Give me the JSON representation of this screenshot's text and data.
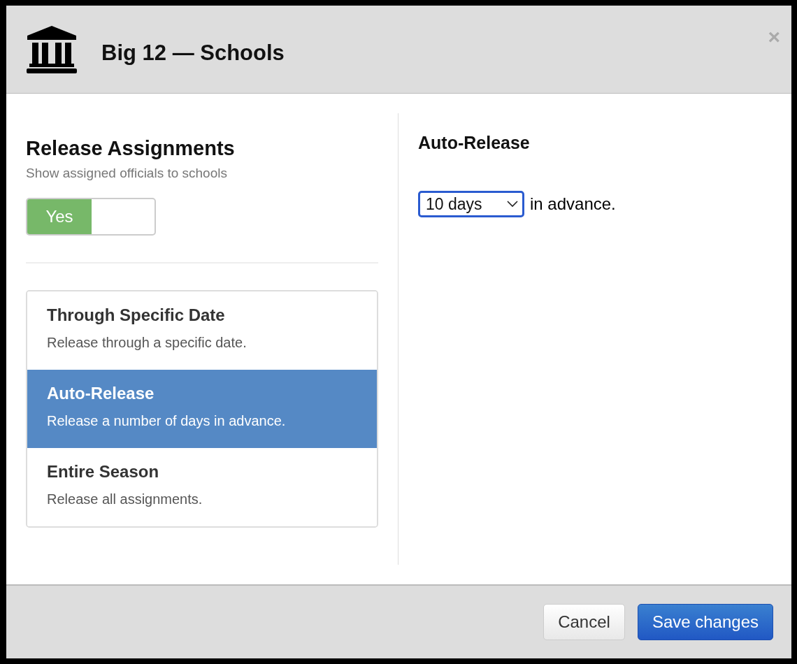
{
  "window": {
    "title": "Big 12 — Schools",
    "close": "×"
  },
  "release": {
    "title": "Release Assignments",
    "subtitle": "Show assigned officials to schools",
    "toggle": {
      "label": "Yes",
      "on": true
    }
  },
  "options": [
    {
      "title": "Through Specific Date",
      "description": "Release through a specific date.",
      "selected": false
    },
    {
      "title": "Auto-Release",
      "description": "Release a number of days in advance.",
      "selected": true
    },
    {
      "title": "Entire Season",
      "description": "Release all assignments.",
      "selected": false
    }
  ],
  "detail": {
    "title": "Auto-Release",
    "select": {
      "value": "10 days"
    },
    "suffix": "in advance."
  },
  "buttons": [
    {
      "label": "Cancel",
      "kind": "default"
    },
    {
      "label": "Save changes",
      "kind": "primary"
    }
  ]
}
